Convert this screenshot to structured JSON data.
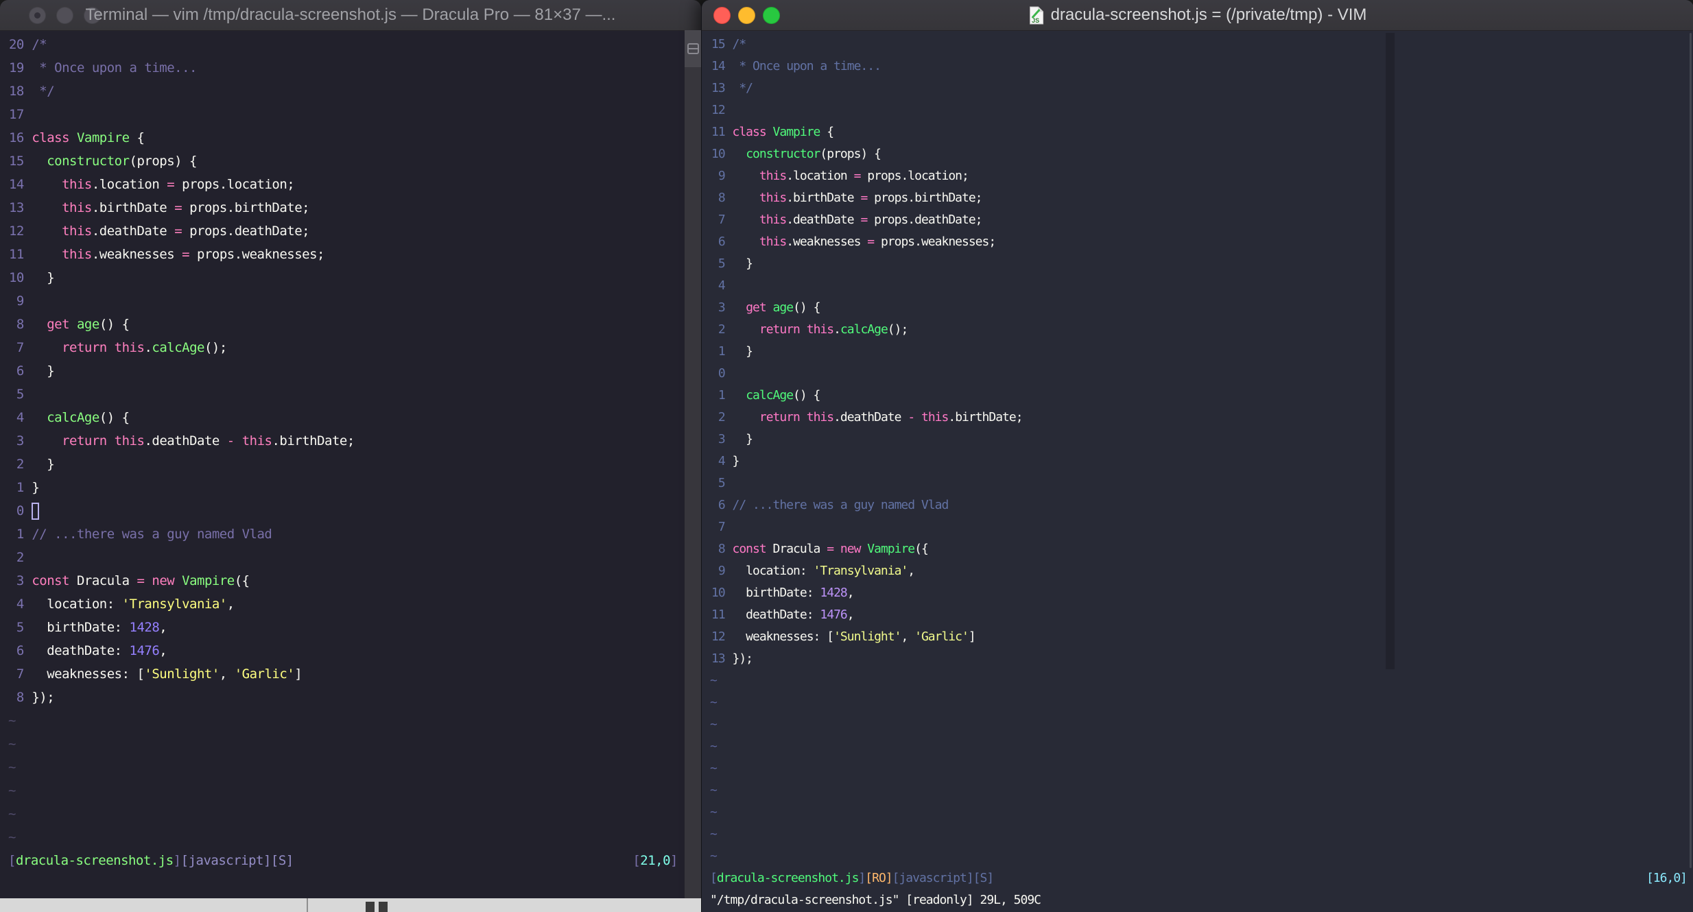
{
  "buffer": {
    "lines": [
      [
        [
          "comment",
          "/*"
        ]
      ],
      [
        [
          "comment",
          " * Once upon a time..."
        ]
      ],
      [
        [
          "comment",
          " */"
        ]
      ],
      [],
      [
        [
          "pink",
          "class"
        ],
        [
          "fg",
          " "
        ],
        [
          "green",
          "Vampire"
        ],
        [
          "fg",
          " {"
        ]
      ],
      [
        [
          "fg",
          "  "
        ],
        [
          "green",
          "constructor"
        ],
        [
          "fg",
          "(props) {"
        ]
      ],
      [
        [
          "fg",
          "    "
        ],
        [
          "pink",
          "this"
        ],
        [
          "fg",
          ".location "
        ],
        [
          "pink",
          "="
        ],
        [
          "fg",
          " props.location;"
        ]
      ],
      [
        [
          "fg",
          "    "
        ],
        [
          "pink",
          "this"
        ],
        [
          "fg",
          ".birthDate "
        ],
        [
          "pink",
          "="
        ],
        [
          "fg",
          " props.birthDate;"
        ]
      ],
      [
        [
          "fg",
          "    "
        ],
        [
          "pink",
          "this"
        ],
        [
          "fg",
          ".deathDate "
        ],
        [
          "pink",
          "="
        ],
        [
          "fg",
          " props.deathDate;"
        ]
      ],
      [
        [
          "fg",
          "    "
        ],
        [
          "pink",
          "this"
        ],
        [
          "fg",
          ".weaknesses "
        ],
        [
          "pink",
          "="
        ],
        [
          "fg",
          " props.weaknesses;"
        ]
      ],
      [
        [
          "fg",
          "  }"
        ]
      ],
      [],
      [
        [
          "fg",
          "  "
        ],
        [
          "pink",
          "get"
        ],
        [
          "fg",
          " "
        ],
        [
          "green",
          "age"
        ],
        [
          "fg",
          "() {"
        ]
      ],
      [
        [
          "fg",
          "    "
        ],
        [
          "pink",
          "return"
        ],
        [
          "fg",
          " "
        ],
        [
          "pink",
          "this"
        ],
        [
          "fg",
          "."
        ],
        [
          "green",
          "calcAge"
        ],
        [
          "fg",
          "();"
        ]
      ],
      [
        [
          "fg",
          "  }"
        ]
      ],
      [],
      [
        [
          "fg",
          "  "
        ],
        [
          "green",
          "calcAge"
        ],
        [
          "fg",
          "() {"
        ]
      ],
      [
        [
          "fg",
          "    "
        ],
        [
          "pink",
          "return"
        ],
        [
          "fg",
          " "
        ],
        [
          "pink",
          "this"
        ],
        [
          "fg",
          ".deathDate "
        ],
        [
          "pink",
          "-"
        ],
        [
          "fg",
          " "
        ],
        [
          "pink",
          "this"
        ],
        [
          "fg",
          ".birthDate;"
        ]
      ],
      [
        [
          "fg",
          "  }"
        ]
      ],
      [
        [
          "fg",
          "}"
        ]
      ],
      [],
      [
        [
          "comment",
          "// ...there was a guy named Vlad"
        ]
      ],
      [],
      [
        [
          "pink",
          "const"
        ],
        [
          "fg",
          " Dracula "
        ],
        [
          "pink",
          "="
        ],
        [
          "fg",
          " "
        ],
        [
          "pink",
          "new"
        ],
        [
          "fg",
          " "
        ],
        [
          "green",
          "Vampire"
        ],
        [
          "fg",
          "({"
        ]
      ],
      [
        [
          "fg",
          "  location: "
        ],
        [
          "yellow",
          "'Transylvania'"
        ],
        [
          "fg",
          ","
        ]
      ],
      [
        [
          "fg",
          "  birthDate: "
        ],
        [
          "purple",
          "1428"
        ],
        [
          "fg",
          ","
        ]
      ],
      [
        [
          "fg",
          "  deathDate: "
        ],
        [
          "purple",
          "1476"
        ],
        [
          "fg",
          ","
        ]
      ],
      [
        [
          "fg",
          "  weaknesses: ["
        ],
        [
          "yellow",
          "'Sunlight'"
        ],
        [
          "fg",
          ", "
        ],
        [
          "yellow",
          "'Garlic'"
        ],
        [
          "fg",
          "]"
        ]
      ],
      [
        [
          "fg",
          "});"
        ]
      ]
    ]
  },
  "left_window": {
    "app": "Terminal",
    "title": "Terminal — vim /tmp/dracula-screenshot.js — Dracula Pro — 81×37 —...",
    "theme_name": "Dracula Pro",
    "traffic_lights": [
      "close",
      "minimize",
      "zoom"
    ],
    "icons": {
      "split_pane": "split-pane-icon"
    },
    "theme": {
      "bg": "#22212C",
      "fg": "#F8F8F2",
      "pink": "#FF80BF",
      "green": "#8AFF80",
      "purple": "#9580FF",
      "yellow": "#FFFF80",
      "comment": "#7970A9",
      "gutter": "#7C73B0",
      "tilde": "#504B6B",
      "cyan": "#80FFEA",
      "orange": "#FFCA80",
      "stbr": "#7970A9",
      "stbr2": "#948DC6",
      "cursorc": "#B9B1EC",
      "titlebar": "#3B3A40",
      "titlefg": "#A0A1A6",
      "colorcolumn": "transparent"
    },
    "editor": {
      "rel_numbers": [
        "20",
        "19",
        "18",
        "17",
        "16",
        "15",
        "14",
        "13",
        "12",
        "11",
        "10",
        "9",
        "8",
        "7",
        "6",
        "5",
        "4",
        "3",
        "2",
        "1",
        "0",
        "1",
        "2",
        "3",
        "4",
        "5",
        "6",
        "7",
        "8"
      ],
      "cursor_index": 20,
      "cursor_style": "hollow",
      "tildes": 6,
      "status": [
        [
          "stbr",
          "["
        ],
        [
          "green",
          "dracula-screenshot.js"
        ],
        [
          "stbr",
          "]"
        ],
        [
          "stbr2",
          "[javascript][S]"
        ]
      ],
      "ruler": [
        [
          "stbr",
          "["
        ],
        [
          "cyan",
          "21,0"
        ],
        [
          "stbr",
          "]"
        ]
      ],
      "cmdline": []
    }
  },
  "right_window": {
    "app": "MacVim",
    "title": "dracula-screenshot.js = (/private/tmp) - VIM",
    "theme_name": "Dracula",
    "traffic_lights": [
      "close",
      "minimize",
      "zoom"
    ],
    "icons": {
      "file_icon": "js-file-icon"
    },
    "theme": {
      "bg": "#282A36",
      "fg": "#F8F8F2",
      "pink": "#FF79C6",
      "green": "#50FA7B",
      "purple": "#BD93F9",
      "yellow": "#F1FA8C",
      "comment": "#6272A4",
      "gutter": "#6272A4",
      "tilde": "#5A639A",
      "cyan": "#8BE9FD",
      "orange": "#FFB86C",
      "stbr": "#6272A4",
      "stbr2": "#6272A4",
      "cursorc": "transparent",
      "titlebar": "#3B3A40",
      "titlefg": "#D8D9DB",
      "colorcolumn": "#21222C"
    },
    "editor": {
      "rel_numbers": [
        "15",
        "14",
        "13",
        "12",
        "11",
        "10",
        "9",
        "8",
        "7",
        "6",
        "5",
        "4",
        "3",
        "2",
        "1",
        "0",
        "1",
        "2",
        "3",
        "4",
        "5",
        "6",
        "7",
        "8",
        "9",
        "10",
        "11",
        "12",
        "13"
      ],
      "cursor_index": -1,
      "cursor_style": "none",
      "tildes": 9,
      "status": [
        [
          "stbr",
          "["
        ],
        [
          "green",
          "dracula-screenshot.js"
        ],
        [
          "stbr",
          "]"
        ],
        [
          "orange",
          "[RO]"
        ],
        [
          "stbr2",
          "[javascript][S]"
        ]
      ],
      "ruler": [
        [
          "cyan",
          "[16,0]"
        ]
      ],
      "cmdline": [
        [
          "fg",
          "\"/tmp/dracula-screenshot.js\" [readonly] 29L, 509C"
        ]
      ]
    }
  },
  "background": {
    "strip_color": "#D8D8D8"
  }
}
